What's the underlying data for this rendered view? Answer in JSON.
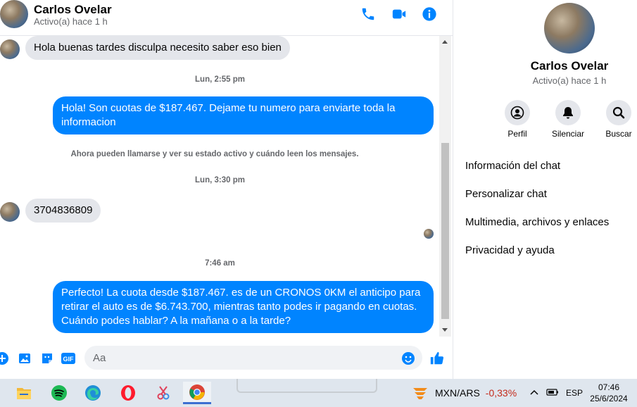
{
  "header": {
    "name": "Carlos Ovelar",
    "status": "Activo(a) hace 1 h",
    "call_icon": "phone-icon",
    "video_icon": "video-icon",
    "info_icon": "info-icon"
  },
  "messages": {
    "m1": "Hola buenas tardes disculpa necesito saber eso bien",
    "ts1": "Lun, 2:55 pm",
    "m2": "Hola! Son cuotas de $187.467. Dejame tu numero para enviarte toda la informacion",
    "system": "Ahora pueden llamarse y ver su estado activo y cuándo leen los mensajes.",
    "ts2": "Lun, 3:30 pm",
    "m3": "3704836809",
    "ts3": "7:46 am",
    "m4": "Perfecto! La cuota desde $187.467. es de un CRONOS 0KM el anticipo para retirar el auto es de $6.743.700, mientras tanto podes ir pagando en cuotas. Cuándo podes hablar? A la mañana o a la tarde?"
  },
  "composer": {
    "placeholder": "Aa"
  },
  "info": {
    "name": "Carlos Ovelar",
    "status": "Activo(a) hace 1 h",
    "actions": [
      {
        "label": "Perfil",
        "icon": "profile-icon"
      },
      {
        "label": "Silenciar",
        "icon": "bell-icon"
      },
      {
        "label": "Buscar",
        "icon": "search-icon"
      }
    ],
    "items": [
      "Información del chat",
      "Personalizar chat",
      "Multimedia, archivos y enlaces",
      "Privacidad y ayuda"
    ]
  },
  "taskbar": {
    "stock_name": "MXN/ARS",
    "stock_change": "-0,33%",
    "language": "ESP",
    "time": "07:46",
    "date": "25/6/2024"
  },
  "colors": {
    "accent": "#0084ff",
    "incoming_bubble": "#e4e6eb",
    "negative": "#c42b1c"
  }
}
